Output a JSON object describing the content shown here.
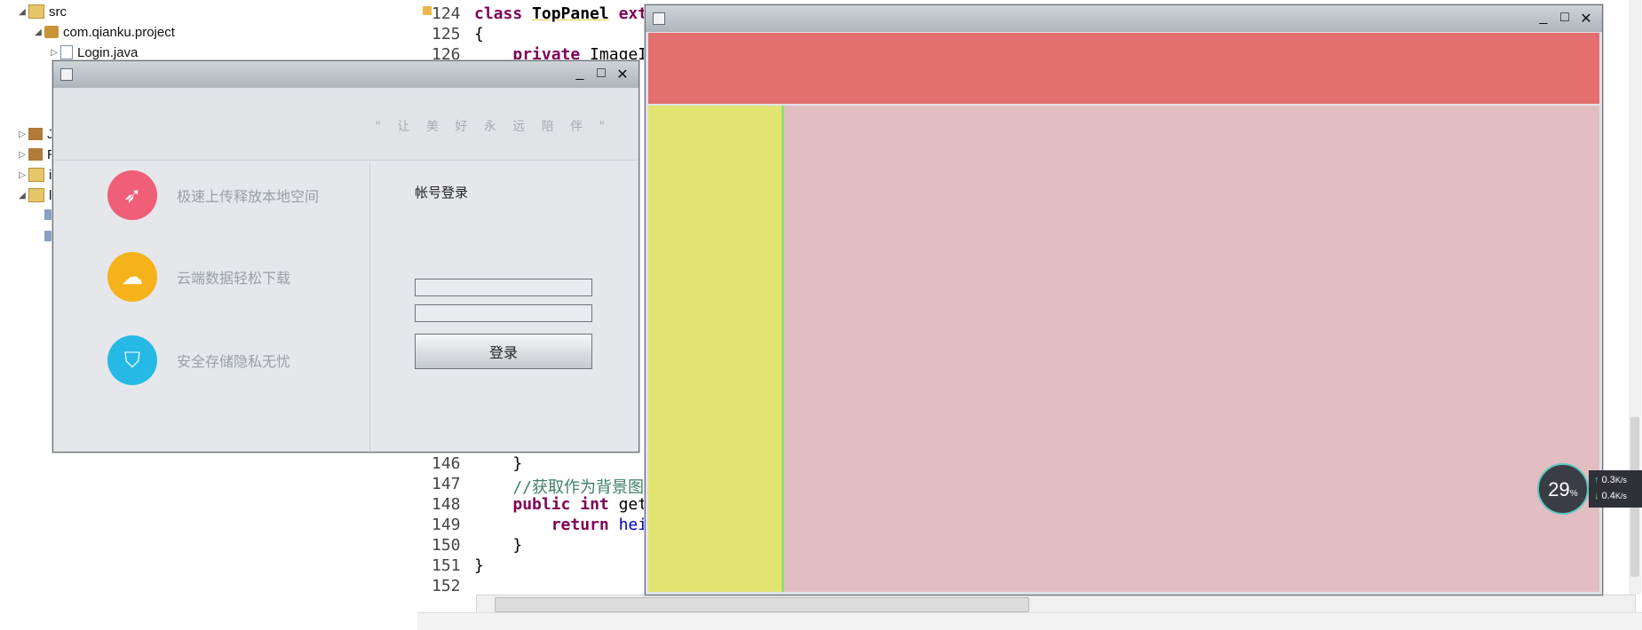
{
  "explorer": {
    "items": [
      {
        "label": "src",
        "tri": "◢"
      },
      {
        "label": "com.qianku.project",
        "tri": "◢"
      },
      {
        "label": "Login.java",
        "tri": "▷"
      },
      {
        "label": "J",
        "tri": "▷"
      },
      {
        "label": "R",
        "tri": "▷"
      },
      {
        "label": "ir",
        "tri": "▷"
      },
      {
        "label": "li",
        "tri": "◢"
      }
    ]
  },
  "editor": {
    "lines": [
      {
        "num": "124",
        "code": "class TopPanel ext"
      },
      {
        "num": "125",
        "code": "{"
      },
      {
        "num": "126",
        "code": "    private ImageI"
      },
      {
        "num": "146",
        "code": "    }"
      },
      {
        "num": "147",
        "code": "    //获取作为背景图片"
      },
      {
        "num": "148",
        "code": "    public int get"
      },
      {
        "num": "149",
        "code": "        return hei"
      },
      {
        "num": "150",
        "code": "    }"
      },
      {
        "num": "151",
        "code": "}"
      },
      {
        "num": "152",
        "code": ""
      }
    ]
  },
  "login_window": {
    "title_controls": {
      "minimize": "_",
      "maximize": "□",
      "close": "✕"
    },
    "slogan": "\" 让 美 好 永 远 陪 伴 \"",
    "features": [
      {
        "icon": "rocket-icon",
        "text": "极速上传释放本地空间",
        "color": "#ef5f78"
      },
      {
        "icon": "cloud-download-icon",
        "text": "云端数据轻松下载",
        "color": "#f6b21a"
      },
      {
        "icon": "shield-icon",
        "text": "安全存储隐私无忧",
        "color": "#26b9e6"
      }
    ],
    "login_title": "帐号登录",
    "username_value": "",
    "password_value": "",
    "login_button": "登录"
  },
  "demo_window": {
    "title_controls": {
      "minimize": "_",
      "maximize": "□",
      "close": "✕"
    },
    "colors": {
      "top": "#e46f6f",
      "left": "#e2e472",
      "main": "#e2bec2",
      "divider": "#8fdf72"
    }
  },
  "net_monitor": {
    "percent": "29",
    "percent_unit": "%",
    "up": "0.3",
    "down": "0.4",
    "unit": "K/s"
  }
}
